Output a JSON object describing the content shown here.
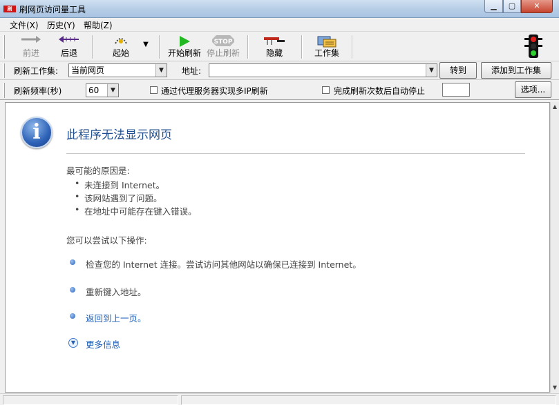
{
  "window": {
    "title": "刷网页访问量工具",
    "app_icon_text": "刷",
    "min_glyph": "▁",
    "max_glyph": "▢",
    "close_glyph": "✕"
  },
  "menu": {
    "file": "文件(X)",
    "history": "历史(Y)",
    "help": "帮助(Z)"
  },
  "toolbar": {
    "forward": "前进",
    "back": "后退",
    "start": "起始",
    "dropdown_glyph": "▼",
    "start_refresh": "开始刷新",
    "stop_refresh": "停止刷新",
    "stop_sign_text": "STOP",
    "hide": "隐藏",
    "workset": "工作集"
  },
  "row1": {
    "workset_label": "刷新工作集:",
    "workset_value": "当前网页",
    "address_label": "地址:",
    "address_value": "",
    "goto_button": "转到",
    "add_button": "添加到工作集"
  },
  "row2": {
    "freq_label": "刷新频率(秒)",
    "freq_value": "60",
    "proxy_label": "通过代理服务器实现多IP刷新",
    "autostop_label": "完成刷新次数后自动停止",
    "autostop_value": "",
    "options_button": "选项..."
  },
  "combo_arrow": "▼",
  "page": {
    "info_glyph": "i",
    "title": "此程序无法显示网页",
    "cause_heading": "最可能的原因是:",
    "causes": [
      "未连接到 Internet。",
      "该网站遇到了问题。",
      "在地址中可能存在键入错误。"
    ],
    "try_heading": "您可以尝试以下操作:",
    "actions": [
      "检查您的 Internet 连接。尝试访问其他网站以确保已连接到 Internet。",
      "重新键入地址。",
      "返回到上一页。"
    ],
    "more_info": "更多信息",
    "more_glyph": "▼"
  },
  "scroll": {
    "up": "▲",
    "down": "▼"
  },
  "colors": {
    "link": "#1a5cb8",
    "title_blue": "#1f4f8f",
    "go_green": "#22b822",
    "close_red": "#c7452f"
  }
}
